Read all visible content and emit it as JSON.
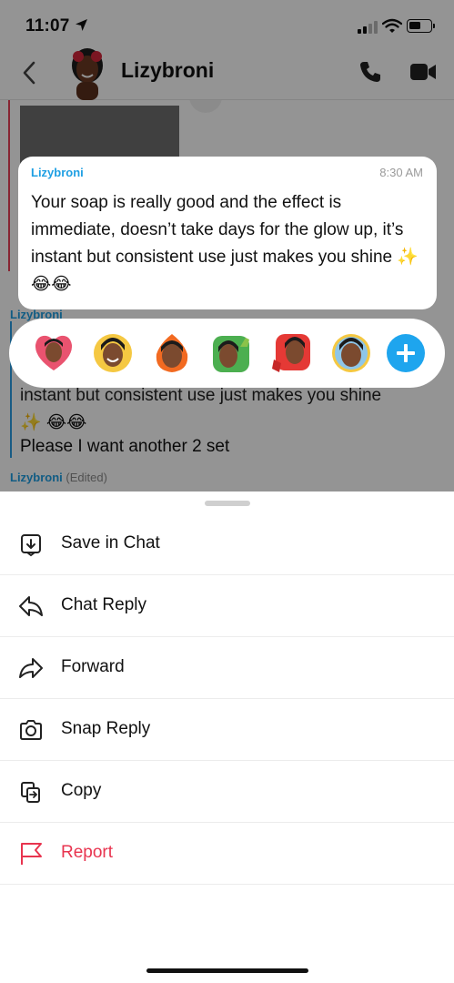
{
  "status_bar": {
    "time": "11:07"
  },
  "header": {
    "title": "Lizybroni"
  },
  "background_chat": {
    "label_1": "Lizybroni",
    "line_1": "instant but consistent use just makes you shine",
    "line_2": "✨ 😂😂",
    "line_3": "Please I want another 2 set",
    "label_2": "Lizybroni",
    "label_2_status": "(Edited)"
  },
  "selected_message": {
    "sender": "Lizybroni",
    "time": "8:30 AM",
    "text": "Your soap is really good and the effect is immediate, doesn’t take days for the glow up, it’s instant but consistent use just makes you shine ✨ 😂😂"
  },
  "reactions": [
    {
      "icon": "heart-bitmoji-icon"
    },
    {
      "icon": "laughing-bitmoji-icon"
    },
    {
      "icon": "fire-bitmoji-icon"
    },
    {
      "icon": "thumbs-up-bitmoji-icon"
    },
    {
      "icon": "thumbs-down-bitmoji-icon"
    },
    {
      "icon": "neutral-bitmoji-icon"
    }
  ],
  "actions": [
    {
      "label": "Save in Chat",
      "icon": "save-in-chat-icon"
    },
    {
      "label": "Chat Reply",
      "icon": "reply-arrow-icon"
    },
    {
      "label": "Forward",
      "icon": "forward-arrow-icon"
    },
    {
      "label": "Snap Reply",
      "icon": "camera-icon"
    },
    {
      "label": "Copy",
      "icon": "copy-icon"
    },
    {
      "label": "Report",
      "icon": "flag-icon"
    }
  ],
  "colors": {
    "accent_blue": "#1e9fe3",
    "report_red": "#e8344f",
    "sender_bar_red": "#e84057"
  }
}
